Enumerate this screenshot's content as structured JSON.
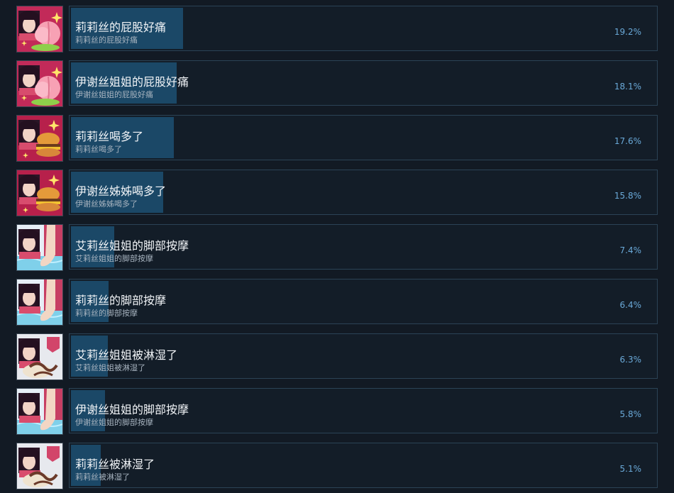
{
  "colors": {
    "background": "#121a24",
    "card_border": "#2b4356",
    "progress_fill": "#1b4867",
    "title_text": "#f0f3f6",
    "desc_text": "#a7b3bf",
    "percent_text": "#6aa9d8"
  },
  "achievements": [
    {
      "title": "莉莉丝的屁股好痛",
      "desc": "莉莉丝的屁股好痛",
      "percent": "19.2%",
      "percent_value": 19.2,
      "icon": "peach-icon"
    },
    {
      "title": "伊谢丝姐姐的屁股好痛",
      "desc": "伊谢丝姐姐的屁股好痛",
      "percent": "18.1%",
      "percent_value": 18.1,
      "icon": "peach-icon"
    },
    {
      "title": "莉莉丝喝多了",
      "desc": "莉莉丝喝多了",
      "percent": "17.6%",
      "percent_value": 17.6,
      "icon": "burger-icon"
    },
    {
      "title": "伊谢丝姊姊喝多了",
      "desc": "伊谢丝姊姊喝多了",
      "percent": "15.8%",
      "percent_value": 15.8,
      "icon": "burger-icon"
    },
    {
      "title": "艾莉丝姐姐的脚部按摩",
      "desc": "艾莉丝姐姐的脚部按摩",
      "percent": "7.4%",
      "percent_value": 7.4,
      "icon": "foot-icon"
    },
    {
      "title": "莉莉丝的脚部按摩",
      "desc": "莉莉丝的脚部按摩",
      "percent": "6.4%",
      "percent_value": 6.4,
      "icon": "foot-icon"
    },
    {
      "title": "艾莉丝姐姐被淋湿了",
      "desc": "艾莉丝姐姐被淋湿了",
      "percent": "6.3%",
      "percent_value": 6.3,
      "icon": "tentacle-icon"
    },
    {
      "title": "伊谢丝姐姐的脚部按摩",
      "desc": "伊谢丝姐姐的脚部按摩",
      "percent": "5.8%",
      "percent_value": 5.8,
      "icon": "foot-icon"
    },
    {
      "title": "莉莉丝被淋湿了",
      "desc": "莉莉丝被淋湿了",
      "percent": "5.1%",
      "percent_value": 5.1,
      "icon": "tentacle-icon"
    }
  ]
}
